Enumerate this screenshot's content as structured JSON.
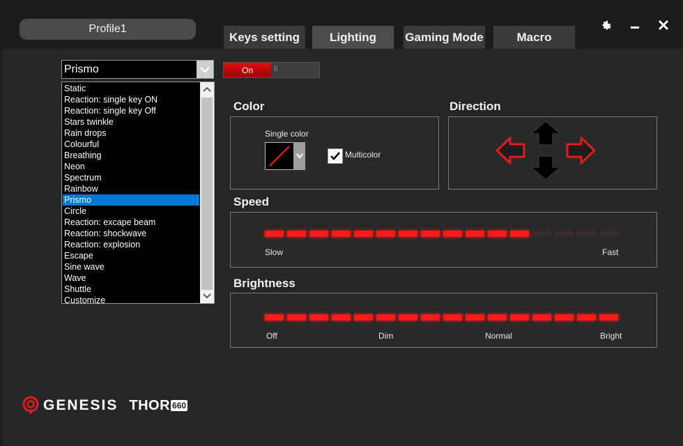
{
  "header": {
    "profile_label": "Profile1",
    "tabs": [
      {
        "label": "Keys setting",
        "active": false
      },
      {
        "label": "Lighting",
        "active": true
      },
      {
        "label": "Gaming Mode",
        "active": false
      },
      {
        "label": "Macro",
        "active": false
      }
    ],
    "icons": [
      "gear-icon",
      "minimize-icon",
      "close-icon"
    ]
  },
  "effect": {
    "selected": "Prismo",
    "items": [
      "Static",
      "Reaction: single key ON",
      "Reaction: single key Off",
      "Stars twinkle",
      "Rain drops",
      "Colourful",
      "Breathing",
      "Neon",
      "Spectrum",
      "Rainbow",
      "Prismo",
      "Circle",
      "Reaction: excape beam",
      "Reaction: shockwave",
      "Reaction: explosion",
      "Escape",
      "Sine wave",
      "Wave",
      "Shuttle",
      "Customize"
    ]
  },
  "toggle": {
    "label": "On",
    "state": "on"
  },
  "color": {
    "title": "Color",
    "single_color_label": "Single color",
    "multicolor_label": "Multicolor",
    "multicolor_checked": true
  },
  "direction": {
    "title": "Direction",
    "arrows": [
      "arrow-left-icon",
      "arrow-up-icon",
      "arrow-down-icon",
      "arrow-right-icon"
    ]
  },
  "speed": {
    "title": "Speed",
    "min_label": "Slow",
    "max_label": "Fast",
    "level": 12,
    "segments": 16
  },
  "brightness": {
    "title": "Brightness",
    "labels": [
      "Off",
      "Dim",
      "Normal",
      "Bright"
    ],
    "level": 16,
    "segments": 16
  },
  "brand": {
    "name": "GENESIS",
    "model": "THOR",
    "model_number": "660"
  },
  "colors": {
    "accent": "#ff1a1a",
    "selection": "#0078d7",
    "background": "#262626"
  }
}
